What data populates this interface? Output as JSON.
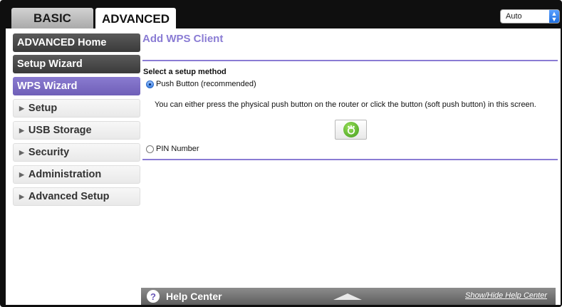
{
  "tabs": {
    "basic_label": "BASIC",
    "advanced_label": "ADVANCED"
  },
  "language_select": {
    "value": "Auto",
    "arrows": "▲▼"
  },
  "sidebar": {
    "items": [
      {
        "label": "ADVANCED Home"
      },
      {
        "label": "Setup Wizard"
      },
      {
        "label": "WPS Wizard"
      },
      {
        "label": "Setup"
      },
      {
        "label": "USB Storage"
      },
      {
        "label": "Security"
      },
      {
        "label": "Administration"
      },
      {
        "label": "Advanced Setup"
      }
    ]
  },
  "main": {
    "title": "Add WPS Client",
    "section_label": "Select a setup method",
    "option_push": "Push Button (recommended)",
    "push_description": "You can either press the physical push button on the router or click the button (soft push button) in this screen.",
    "option_pin": "PIN Number",
    "wps_button_icon": "wps-icon"
  },
  "help": {
    "icon": "?",
    "label": "Help Center",
    "toggle_link": "Show/Hide Help Center"
  },
  "colors": {
    "accent": "#8a7cd4",
    "active_nav": "#7566c0",
    "dark_nav": "#4a4a4a",
    "wps_green": "#5fb82a"
  }
}
